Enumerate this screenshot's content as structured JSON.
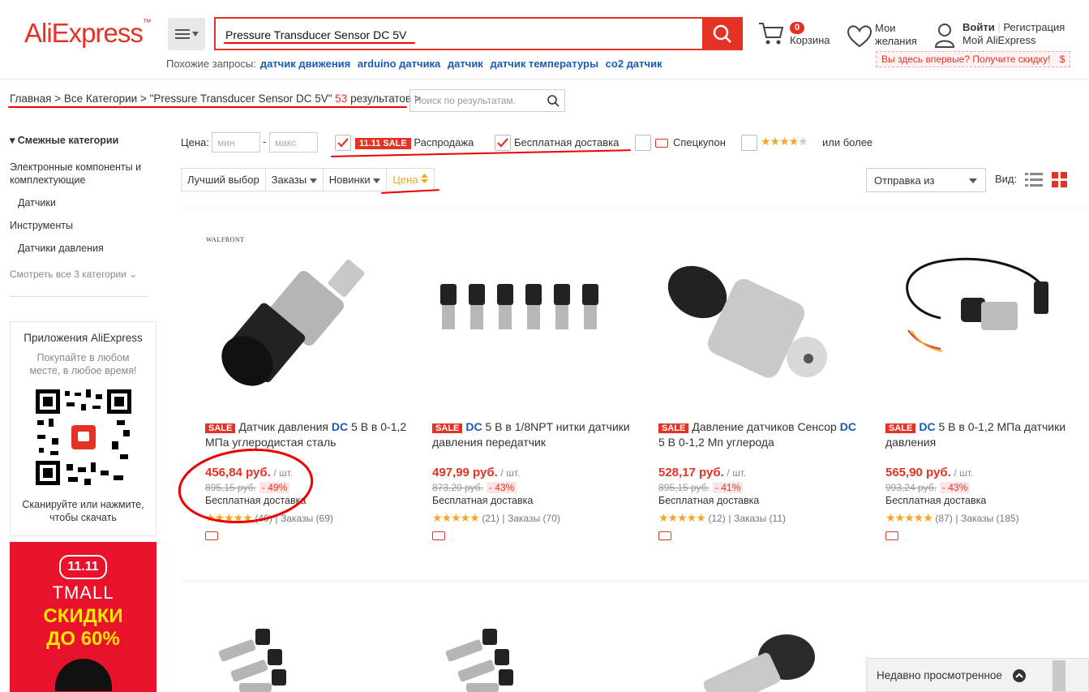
{
  "header": {
    "logo_main": "AliExpress",
    "logo_tm": "™",
    "search_value": "Pressure Transducer Sensor DC 5V",
    "related_label": "Похожие запросы:",
    "related": [
      "датчик движения",
      "arduino датчика",
      "датчик",
      "датчик температуры",
      "co2 датчик"
    ],
    "cart_count": "0",
    "cart_label": "Корзина",
    "wishlist_line1": "Мои",
    "wishlist_line2": "желания",
    "login": "Войти",
    "register": "Регистрация",
    "my_ali": "Мой AliExpress",
    "promo": "Вы здесь впервые? Получите скидку!",
    "promo_icon": "$"
  },
  "breadcrumb": {
    "home": "Главная",
    "sep": ">",
    "all": "Все Категории",
    "query": "\"Pressure Transducer Sensor DC 5V\"",
    "count": "53",
    "results": "результатов",
    "refine_placeholder": "Поиск по результатам."
  },
  "sidebar": {
    "title": "Смежные категории",
    "items": [
      "Электронные компоненты и",
      "комплектующие",
      "Датчики",
      "Инструменты",
      "Датчики давления"
    ],
    "more": "Смотреть все 3 категории",
    "app_title": "Приложения AliExpress",
    "app_sub1": "Покупайте в любом",
    "app_sub2": "месте, в любое время!",
    "app_scan1": "Сканируйте или нажмите,",
    "app_scan2": "чтобы скачать",
    "tmall_logo": "11.11",
    "tmall": "TMALL",
    "tmall_sale1": "СКИДКИ",
    "tmall_sale2": "ДО 60%"
  },
  "filters": {
    "price_label": "Цена:",
    "min": "мин",
    "max": "макс",
    "sale_tag": "11.11 SALE",
    "sale": "Распродажа",
    "free_ship": "Бесплатная доставка",
    "coupon": "Спецкупон",
    "rating": "или более",
    "sort": [
      "Лучший выбор",
      "Заказы",
      "Новинки",
      "Цена"
    ],
    "ship_from": "Отправка из",
    "view": "Вид:"
  },
  "products": [
    {
      "brand": "WALFRONT",
      "sale": "SALE",
      "title_a": "Датчик давления ",
      "title_b": "DC",
      "title_c": " 5 В в 0-1,2 МПа углеродистая сталь",
      "price": "456,84 руб.",
      "unit": "/ шт.",
      "old": "895,15 руб.",
      "disc": "- 49%",
      "free": "Бесплатная доставка",
      "reviews": "(40)",
      "orders": "Заказы (69)"
    },
    {
      "brand": "",
      "sale": "SALE",
      "title_a": "",
      "title_b": "DC",
      "title_c": " 5 В в 1/8NPT нитки датчики давления передатчик",
      "price": "497,99 руб.",
      "unit": "/ шт.",
      "old": "873,20 руб.",
      "disc": "- 43%",
      "free": "Бесплатная доставка",
      "reviews": "(21)",
      "orders": "Заказы (70)"
    },
    {
      "brand": "",
      "sale": "SALE",
      "title_a": "Давление датчиков Сенсор ",
      "title_b": "DC",
      "title_c": " 5 В 0-1,2 Мп углерода",
      "price": "528,17 руб.",
      "unit": "/ шт.",
      "old": "895,15 руб.",
      "disc": "- 41%",
      "free": "Бесплатная доставка",
      "reviews": "(12)",
      "orders": "Заказы (11)"
    },
    {
      "brand": "",
      "sale": "SALE",
      "title_a": "",
      "title_b": "DC",
      "title_c": " 5 В в 0-1,2 МПа датчики давления",
      "price": "565,90 руб.",
      "unit": "/ шт.",
      "old": "993,24 руб.",
      "disc": "- 43%",
      "free": "Бесплатная доставка",
      "reviews": "(87)",
      "orders": "Заказы (185)"
    }
  ],
  "recent": "Недавно просмотренное",
  "colors": {
    "brand": "#e43225",
    "link": "#1a5bb5"
  }
}
